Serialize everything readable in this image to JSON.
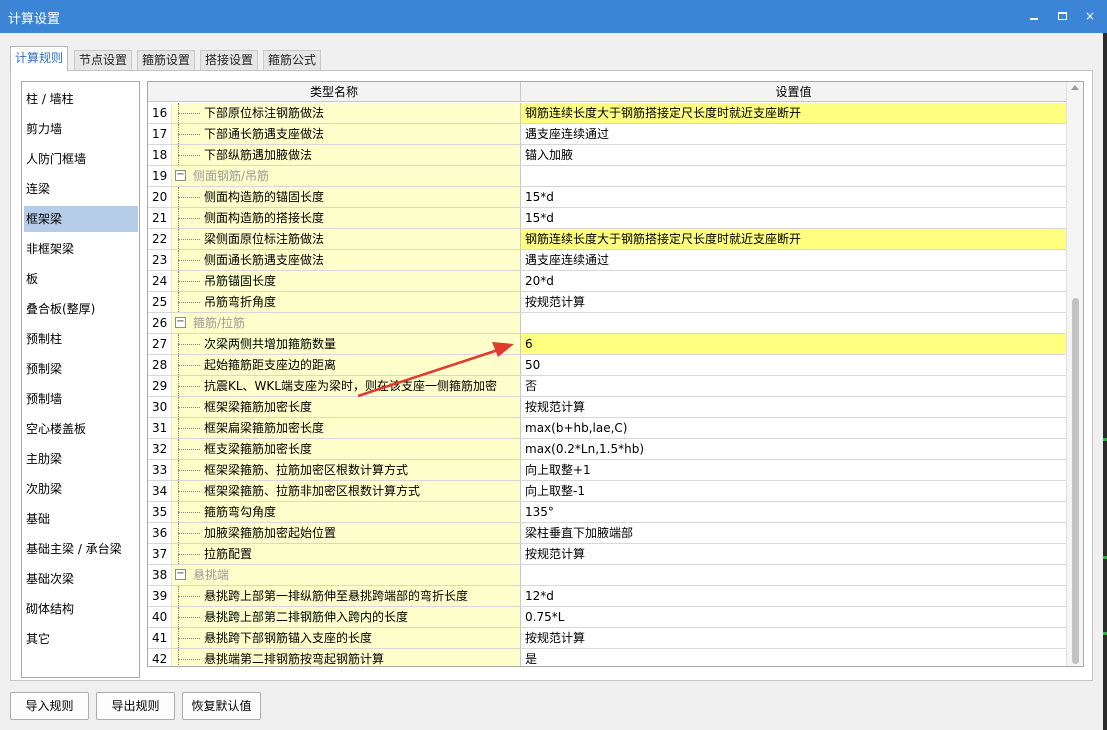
{
  "window": {
    "title": "计算设置",
    "minimize_icon": "minimize-icon",
    "maximize_icon": "maximize-icon",
    "close_icon": "close-icon",
    "close_glyph": "×"
  },
  "tabs": [
    {
      "label": "计算规则",
      "active": true
    },
    {
      "label": "节点设置",
      "active": false
    },
    {
      "label": "箍筋设置",
      "active": false
    },
    {
      "label": "搭接设置",
      "active": false
    },
    {
      "label": "箍筋公式",
      "active": false
    }
  ],
  "sidebar": {
    "selected_index": 4,
    "items": [
      {
        "label": "柱 / 墙柱"
      },
      {
        "label": "剪力墙"
      },
      {
        "label": "人防门框墙"
      },
      {
        "label": "连梁"
      },
      {
        "label": "框架梁"
      },
      {
        "label": "非框架梁"
      },
      {
        "label": "板"
      },
      {
        "label": "叠合板(整厚)"
      },
      {
        "label": "预制柱"
      },
      {
        "label": "预制梁"
      },
      {
        "label": "预制墙"
      },
      {
        "label": "空心楼盖板"
      },
      {
        "label": "主肋梁"
      },
      {
        "label": "次肋梁"
      },
      {
        "label": "基础"
      },
      {
        "label": "基础主梁 / 承台梁"
      },
      {
        "label": "基础次梁"
      },
      {
        "label": "砌体结构"
      },
      {
        "label": "其它"
      }
    ]
  },
  "table": {
    "headers": {
      "name": "类型名称",
      "value": "设置值"
    },
    "collapse_glyph": "−",
    "rows": [
      {
        "num": "16",
        "name": "下部原位标注钢筋做法",
        "value": "钢筋连续长度大于钢筋搭接定尺长度时就近支座断开",
        "highlight": true
      },
      {
        "num": "17",
        "name": "下部通长筋遇支座做法",
        "value": "遇支座连续通过"
      },
      {
        "num": "18",
        "name": "下部纵筋遇加腋做法",
        "value": "锚入加腋"
      },
      {
        "num": "19",
        "name": "侧面钢筋/吊筋",
        "value": "",
        "group": true
      },
      {
        "num": "20",
        "name": "侧面构造筋的锚固长度",
        "value": "15*d"
      },
      {
        "num": "21",
        "name": "侧面构造筋的搭接长度",
        "value": "15*d"
      },
      {
        "num": "22",
        "name": "梁侧面原位标注筋做法",
        "value": "钢筋连续长度大于钢筋搭接定尺长度时就近支座断开",
        "highlight": true
      },
      {
        "num": "23",
        "name": "侧面通长筋遇支座做法",
        "value": "遇支座连续通过"
      },
      {
        "num": "24",
        "name": "吊筋锚固长度",
        "value": "20*d"
      },
      {
        "num": "25",
        "name": "吊筋弯折角度",
        "value": "按规范计算"
      },
      {
        "num": "26",
        "name": "箍筋/拉筋",
        "value": "",
        "group": true
      },
      {
        "num": "27",
        "name": "次梁两侧共增加箍筋数量",
        "value": "6",
        "highlight": true
      },
      {
        "num": "28",
        "name": "起始箍筋距支座边的距离",
        "value": "50"
      },
      {
        "num": "29",
        "name": "抗震KL、WKL端支座为梁时，则在该支座一侧箍筋加密",
        "value": "否"
      },
      {
        "num": "30",
        "name": "框架梁箍筋加密长度",
        "value": "按规范计算"
      },
      {
        "num": "31",
        "name": "框架扁梁箍筋加密长度",
        "value": "max(b+hb,lae,C)"
      },
      {
        "num": "32",
        "name": "框支梁箍筋加密长度",
        "value": "max(0.2*Ln,1.5*hb)"
      },
      {
        "num": "33",
        "name": "框架梁箍筋、拉筋加密区根数计算方式",
        "value": "向上取整+1"
      },
      {
        "num": "34",
        "name": "框架梁箍筋、拉筋非加密区根数计算方式",
        "value": "向上取整-1"
      },
      {
        "num": "35",
        "name": "箍筋弯勾角度",
        "value": "135°"
      },
      {
        "num": "36",
        "name": "加腋梁箍筋加密起始位置",
        "value": "梁柱垂直下加腋端部"
      },
      {
        "num": "37",
        "name": "拉筋配置",
        "value": "按规范计算"
      },
      {
        "num": "38",
        "name": "悬挑端",
        "value": "",
        "group": true
      },
      {
        "num": "39",
        "name": "悬挑跨上部第一排纵筋伸至悬挑跨端部的弯折长度",
        "value": "12*d"
      },
      {
        "num": "40",
        "name": "悬挑跨上部第二排钢筋伸入跨内的长度",
        "value": "0.75*L"
      },
      {
        "num": "41",
        "name": "悬挑跨下部钢筋锚入支座的长度",
        "value": "按规范计算"
      },
      {
        "num": "42",
        "name": "悬挑端第二排钢筋按弯起钢筋计算",
        "value": "是"
      }
    ]
  },
  "buttons": {
    "import": "导入规则",
    "export": "导出规则",
    "restore": "恢复默认值"
  },
  "annotation": {
    "arrow_color": "#e23b2e",
    "target_row": "27"
  },
  "colors": {
    "titlebar": "#3c84d6",
    "row_highlight": "#ffff80",
    "name_cell": "#ffffcc",
    "sidebar_selected": "#b6cde9"
  }
}
